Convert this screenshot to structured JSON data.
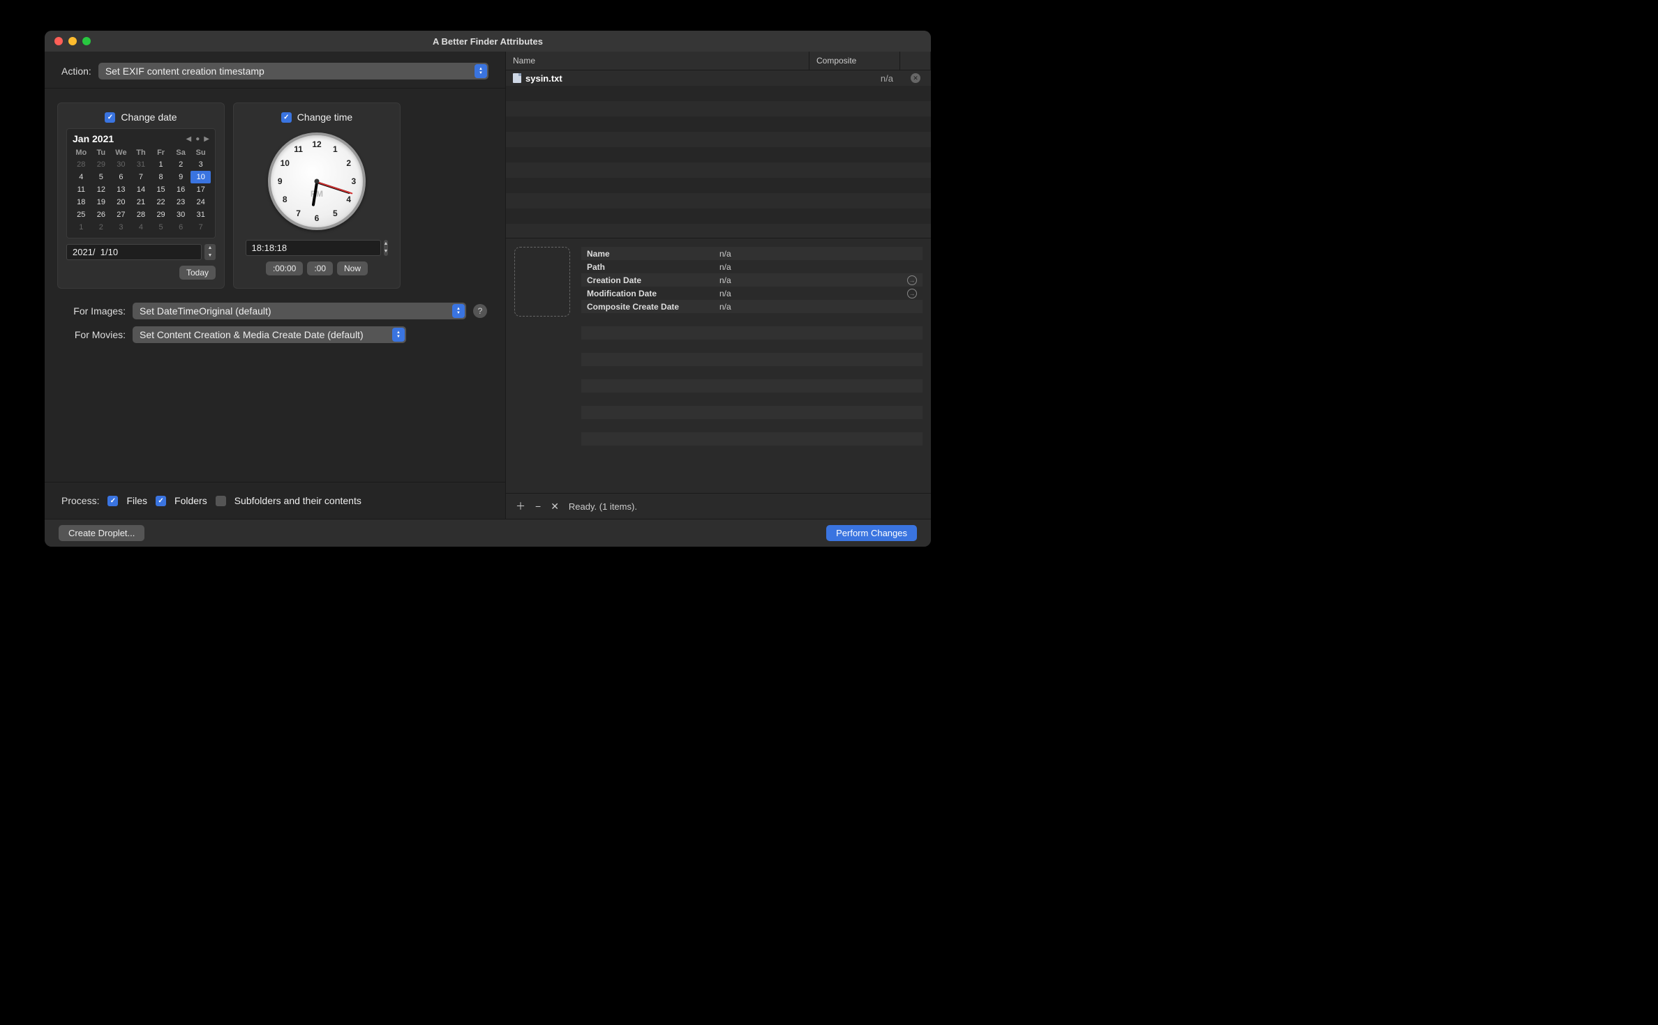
{
  "window": {
    "title": "A Better Finder Attributes"
  },
  "action": {
    "label": "Action:",
    "value": "Set EXIF content creation timestamp"
  },
  "change_date": {
    "checkbox_label": "Change date",
    "checked": true,
    "month_title": "Jan 2021",
    "weekdays": [
      "Mo",
      "Tu",
      "We",
      "Th",
      "Fr",
      "Sa",
      "Su"
    ],
    "grid": [
      {
        "d": "28",
        "muted": true
      },
      {
        "d": "29",
        "muted": true
      },
      {
        "d": "30",
        "muted": true
      },
      {
        "d": "31",
        "muted": true
      },
      {
        "d": "1"
      },
      {
        "d": "2"
      },
      {
        "d": "3"
      },
      {
        "d": "4"
      },
      {
        "d": "5"
      },
      {
        "d": "6"
      },
      {
        "d": "7"
      },
      {
        "d": "8"
      },
      {
        "d": "9"
      },
      {
        "d": "10",
        "sel": true
      },
      {
        "d": "11"
      },
      {
        "d": "12"
      },
      {
        "d": "13"
      },
      {
        "d": "14"
      },
      {
        "d": "15"
      },
      {
        "d": "16"
      },
      {
        "d": "17"
      },
      {
        "d": "18"
      },
      {
        "d": "19"
      },
      {
        "d": "20"
      },
      {
        "d": "21"
      },
      {
        "d": "22"
      },
      {
        "d": "23"
      },
      {
        "d": "24"
      },
      {
        "d": "25"
      },
      {
        "d": "26"
      },
      {
        "d": "27"
      },
      {
        "d": "28"
      },
      {
        "d": "29"
      },
      {
        "d": "30"
      },
      {
        "d": "31"
      },
      {
        "d": "1",
        "muted": true
      },
      {
        "d": "2",
        "muted": true
      },
      {
        "d": "3",
        "muted": true
      },
      {
        "d": "4",
        "muted": true
      },
      {
        "d": "5",
        "muted": true
      },
      {
        "d": "6",
        "muted": true
      },
      {
        "d": "7",
        "muted": true
      }
    ],
    "date_input": "2021/  1/10",
    "today_button": "Today"
  },
  "change_time": {
    "checkbox_label": "Change time",
    "checked": true,
    "ampm": "PM",
    "time_input": "18:18:18",
    "reset_00_00": ":00:00",
    "reset_00": ":00",
    "now_button": "Now",
    "clock_numbers": [
      "12",
      "1",
      "2",
      "3",
      "4",
      "5",
      "6",
      "7",
      "8",
      "9",
      "10",
      "11"
    ]
  },
  "for_images": {
    "label": "For Images:",
    "value": "Set DateTimeOriginal (default)"
  },
  "for_movies": {
    "label": "For Movies:",
    "value": "Set Content Creation & Media Create Date (default)"
  },
  "process": {
    "label": "Process:",
    "files": "Files",
    "folders": "Folders",
    "subfolders": "Subfolders and their contents"
  },
  "files_table": {
    "header_name": "Name",
    "header_composite": "Composite",
    "rows": [
      {
        "name": "sysin.txt",
        "composite": "n/a"
      }
    ]
  },
  "details": {
    "rows": [
      {
        "k": "Name",
        "v": "n/a",
        "arrow": false
      },
      {
        "k": "Path",
        "v": "n/a",
        "arrow": false
      },
      {
        "k": "Creation Date",
        "v": "n/a",
        "arrow": true
      },
      {
        "k": "Modification Date",
        "v": "n/a",
        "arrow": true
      },
      {
        "k": "Composite Create Date",
        "v": "n/a",
        "arrow": false
      }
    ]
  },
  "status": "Ready. (1 items).",
  "footer": {
    "create_droplet": "Create Droplet...",
    "perform_changes": "Perform Changes"
  }
}
